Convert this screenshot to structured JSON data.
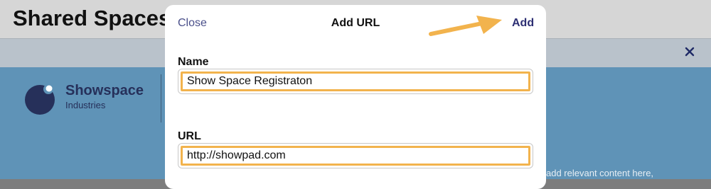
{
  "app": {
    "title": "Shared Spaces",
    "banner_close_icon": "close-icon"
  },
  "hero": {
    "brand_name": "Showspace",
    "brand_sub": "Industries",
    "body_text": "add relevant content here,"
  },
  "modal": {
    "close_label": "Close",
    "title": "Add URL",
    "add_label": "Add",
    "name_label": "Name",
    "name_value": "Show Space Registraton",
    "url_label": "URL",
    "url_value": "http://showpad.com"
  },
  "colors": {
    "accent": "#2d2f73",
    "highlight": "#f2b34d",
    "hero_bg": "#5f93b7"
  }
}
